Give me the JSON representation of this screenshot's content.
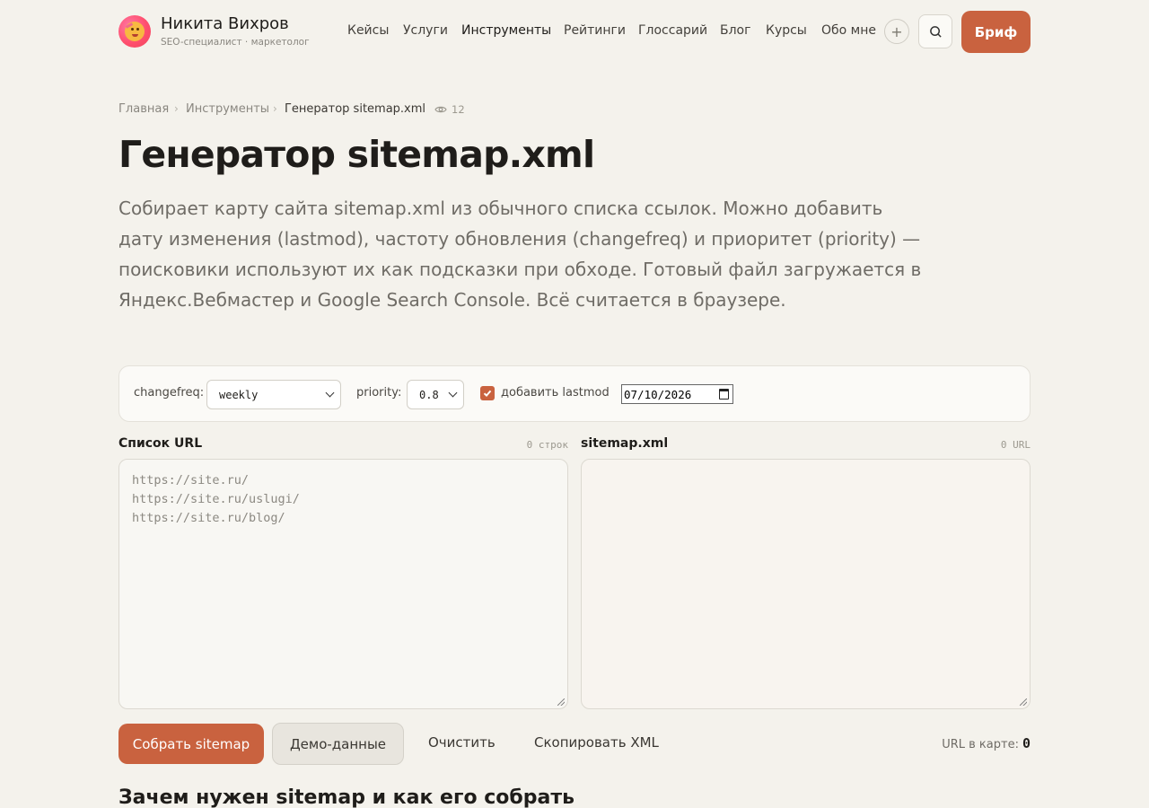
{
  "header": {
    "brand_name": "Никита Вихров",
    "brand_sub": "SEO-специалист · маркетолог",
    "nav": [
      "Кейсы",
      "Услуги",
      "Инструменты",
      "Рейтинги",
      "Глоссарий",
      "Блог",
      "Курсы",
      "Обо мне"
    ],
    "active_nav": "Инструменты",
    "plus_label": "+",
    "brief_label": "Бриф"
  },
  "breadcrumb": {
    "items": [
      "Главная",
      "Инструменты",
      "Генератор sitemap.xml"
    ],
    "separator": "›",
    "views": "12"
  },
  "page": {
    "title": "Генератор sitemap.xml",
    "lead": "Собирает карту сайта sitemap.xml из обычного списка ссылок. Можно добавить дату изменения (lastmod), частоту обновления (changefreq) и приоритет (priority) — поисковики используют их как подсказки при обходе. Готовый файл загружается в Яндекс.Вебмастер и Google Search Console. Всё считается в браузере."
  },
  "options": {
    "changefreq_label": "changefreq:",
    "changefreq_value": "weekly",
    "priority_label": "priority:",
    "priority_value": "0.8",
    "lastmod_label": "добавить lastmod",
    "lastmod_checked": true,
    "date_value": "07/10/2026"
  },
  "panels": {
    "input_title": "Список URL",
    "input_count": "0 строк",
    "input_placeholder": "https://site.ru/\nhttps://site.ru/uslugi/\nhttps://site.ru/blog/",
    "output_title": "sitemap.xml",
    "output_count": "0 URL"
  },
  "actions": {
    "build": "Собрать sitemap",
    "demo": "Демо-данные",
    "clear": "Очистить",
    "copy": "Скопировать XML",
    "url_count_label": "URL в карте:",
    "url_count_value": "0"
  },
  "section": {
    "title": "Зачем нужен sitemap и как его собрать"
  },
  "colors": {
    "accent": "#c9623f",
    "background": "#f4f2ec"
  }
}
